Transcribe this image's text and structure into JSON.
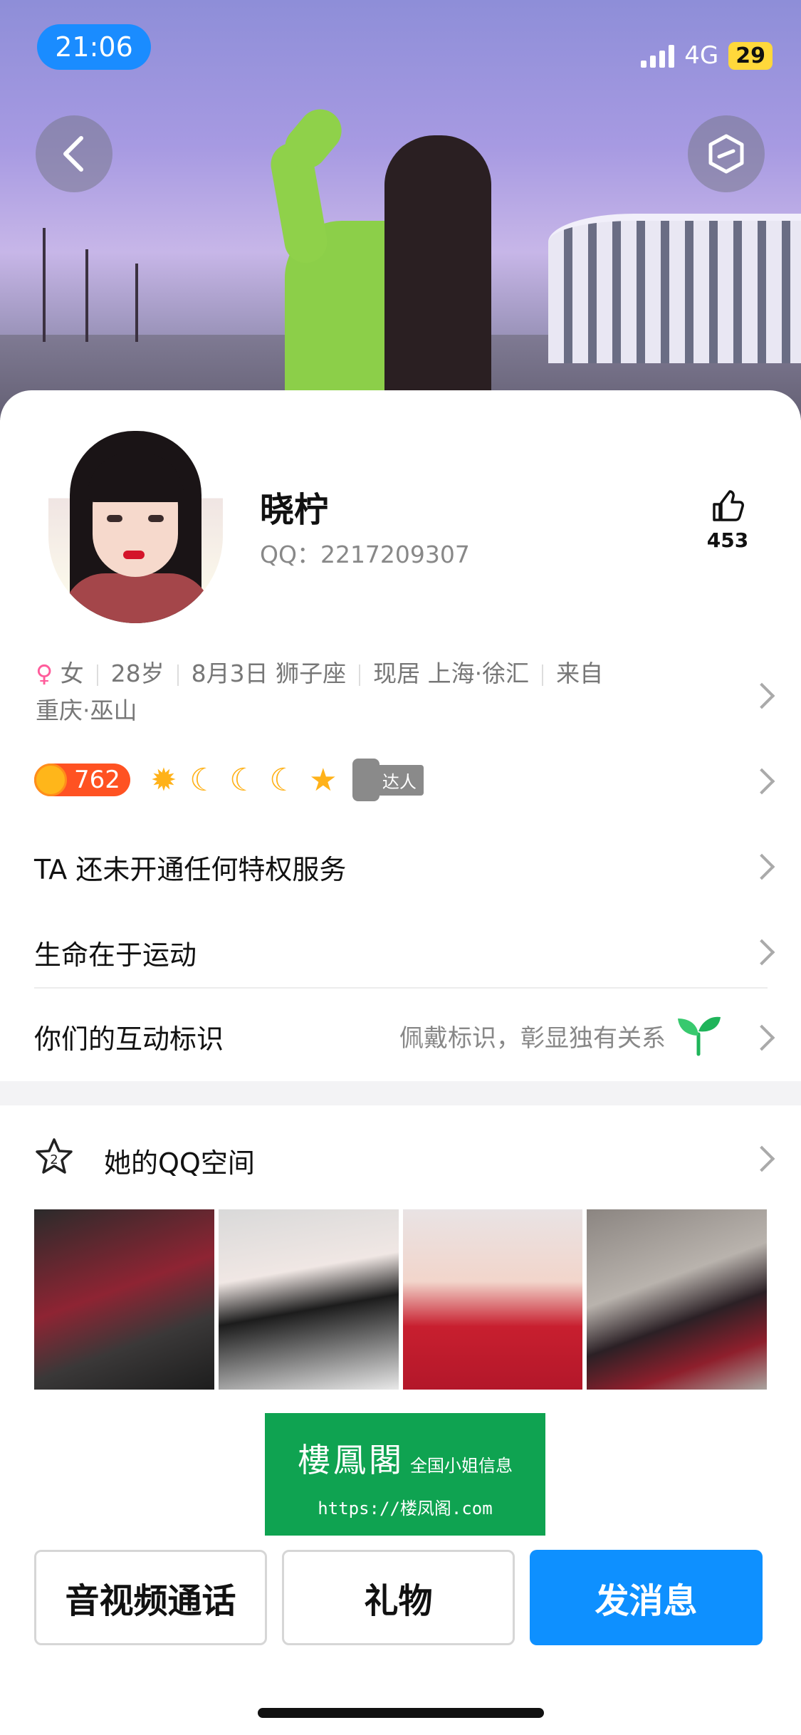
{
  "status_bar": {
    "time": "21:06",
    "network": "4G",
    "battery": "29"
  },
  "profile": {
    "nickname": "晓柠",
    "qq_label": "QQ：2217209307",
    "likes": "453"
  },
  "info": {
    "gender_symbol": "♀",
    "gender": "女",
    "age": "28岁",
    "birthday": "8月3日 狮子座",
    "location": "现居 上海·徐汇",
    "hometown_prefix": "来自",
    "hometown": "重庆·巫山"
  },
  "badges": {
    "level": "762",
    "talent_label": "达人"
  },
  "rows": {
    "privilege": "TA 还未开通任何特权服务",
    "signature": "生命在于运动",
    "interaction_title": "你们的互动标识",
    "interaction_desc": "佩戴标识，彰显独有关系"
  },
  "qzone": {
    "title": "她的QQ空间"
  },
  "ad": {
    "title_cn": "樓鳳閣",
    "subtitle": "全国小姐信息",
    "url": "https://楼凤阁.com"
  },
  "actions": {
    "call": "音视频通话",
    "gift": "礼物",
    "message": "发消息"
  },
  "colors": {
    "accent": "#0e90ff",
    "female": "#ff5c9b",
    "level_bg": "#ff5222",
    "ad_bg": "#0fa351"
  }
}
